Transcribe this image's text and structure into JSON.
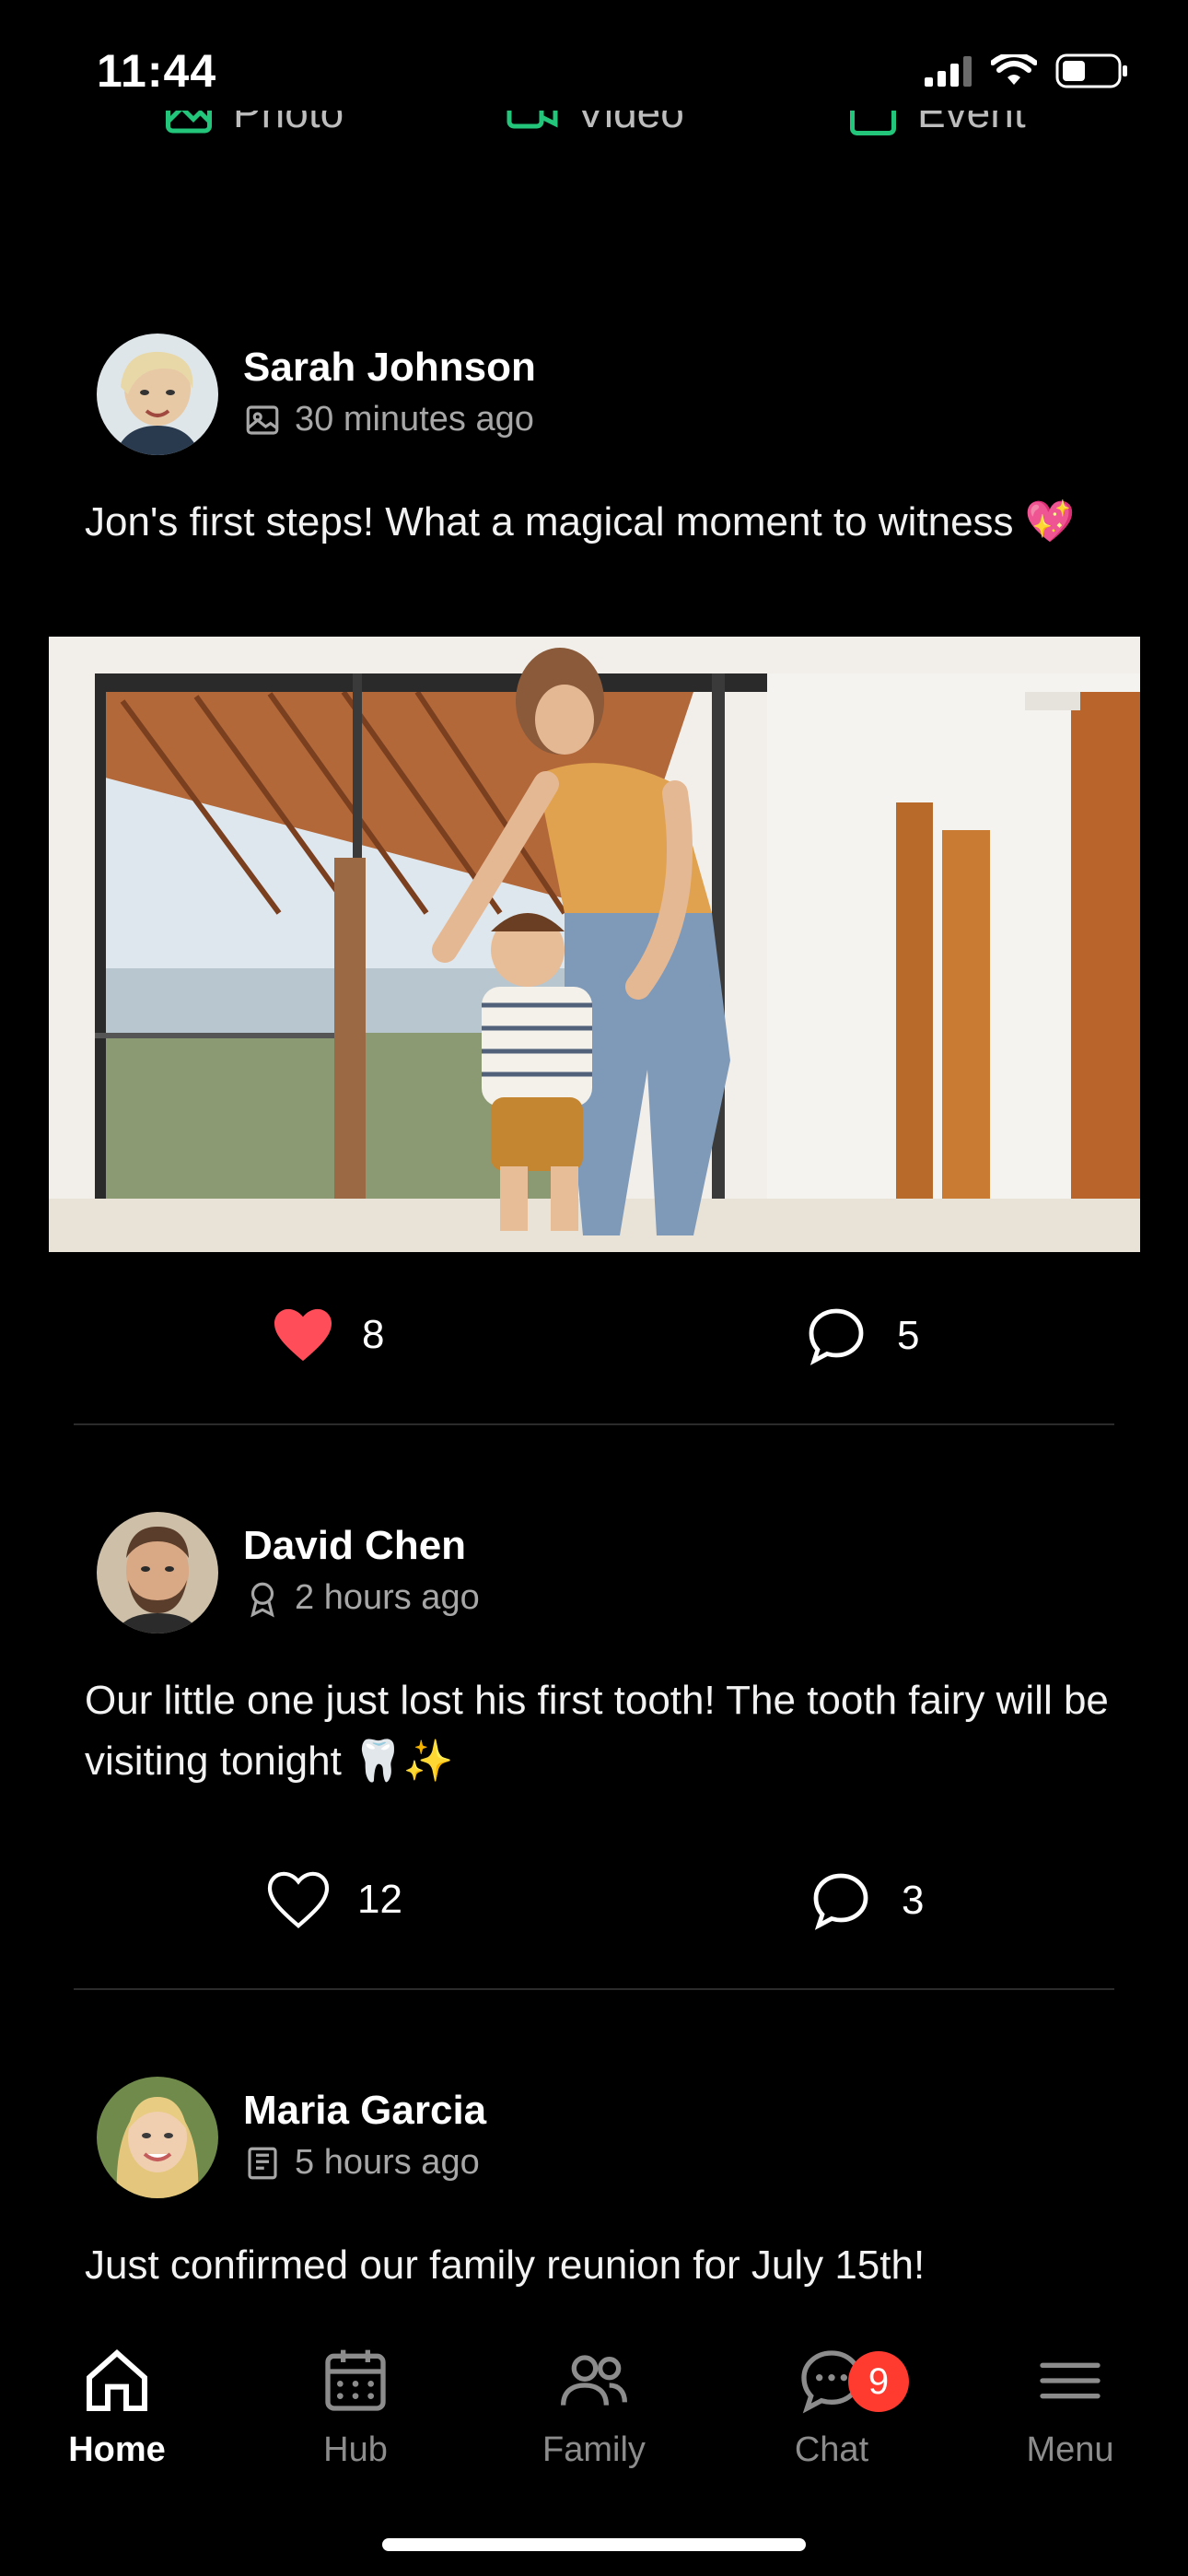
{
  "status_bar": {
    "time": "11:44"
  },
  "composer": {
    "photo_label": "Photo",
    "video_label": "Video",
    "event_label": "Event"
  },
  "posts": [
    {
      "author": "Sarah Johnson",
      "time": "30 minutes ago",
      "text": "Jon's first steps! What a magical moment to witness 💖",
      "likes": "8",
      "comments": "5",
      "liked": true,
      "type_icon": "image-icon"
    },
    {
      "author": "David Chen",
      "time": "2 hours ago",
      "text": "Our little one just lost his first tooth! The tooth fairy will be visiting tonight 🦷✨",
      "likes": "12",
      "comments": "3",
      "liked": false,
      "type_icon": "award-icon"
    },
    {
      "author": "Maria Garcia",
      "time": "5 hours ago",
      "text": "Just confirmed our family reunion for July 15th!",
      "type_icon": "newspaper-icon"
    }
  ],
  "tabbar": {
    "home": "Home",
    "hub": "Hub",
    "family": "Family",
    "chat": "Chat",
    "menu": "Menu",
    "chat_badge": "9",
    "active": "home"
  },
  "colors": {
    "accent_green": "#22c57a",
    "like_red": "#ff4d5a",
    "badge_red": "#ff3b30"
  }
}
